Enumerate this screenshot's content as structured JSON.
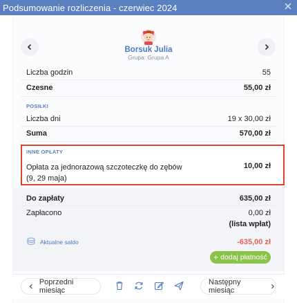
{
  "window": {
    "title": "Podsumowanie rozliczenia - czerwiec 2024"
  },
  "child": {
    "name": "Borsuk Julia",
    "group": "Grupa: Grupa A"
  },
  "summary": {
    "hours_label": "Liczba godzin",
    "hours_value": "55",
    "tuition_label": "Czesne",
    "tuition_value": "55,00 zł"
  },
  "meals": {
    "section": "POSIŁKI",
    "days_label": "Liczba dni",
    "days_value": "19 x 30,00 zł",
    "sum_label": "Suma",
    "sum_value": "570,00 zł"
  },
  "other_fees": {
    "section": "INNE OPŁATY",
    "item_line1": "Opłata za jednorazową szczoteczkę do zębów",
    "item_line2": "(9, 29 maja)",
    "item_value": "10,00 zł"
  },
  "payment": {
    "due_label": "Do zapłaty",
    "due_value": "635,00 zł",
    "paid_label": "Zapłacono",
    "paid_value": "0,00 zł",
    "payments_link": "(lista wpłat)",
    "balance_label": "Aktualne saldo",
    "balance_value": "-635,00 zł",
    "add_payment": "dodaj płatność"
  },
  "footer": {
    "prev_month": "Poprzedni miesiąc",
    "next_month": "Następny miesiąc"
  },
  "colors": {
    "titlebar": "#5b80c0",
    "link": "#4a78c2",
    "paid": "#6fb92e",
    "balance": "#e85c5c",
    "highlight": "#e0412c",
    "add_button": "#8bc34a"
  },
  "icons": {
    "close": "close-icon",
    "prev": "chevron-left-icon",
    "next": "chevron-right-icon",
    "delete": "trash-icon",
    "refresh": "refresh-icon",
    "edit": "edit-icon",
    "send": "send-icon",
    "balance": "coins-icon"
  }
}
